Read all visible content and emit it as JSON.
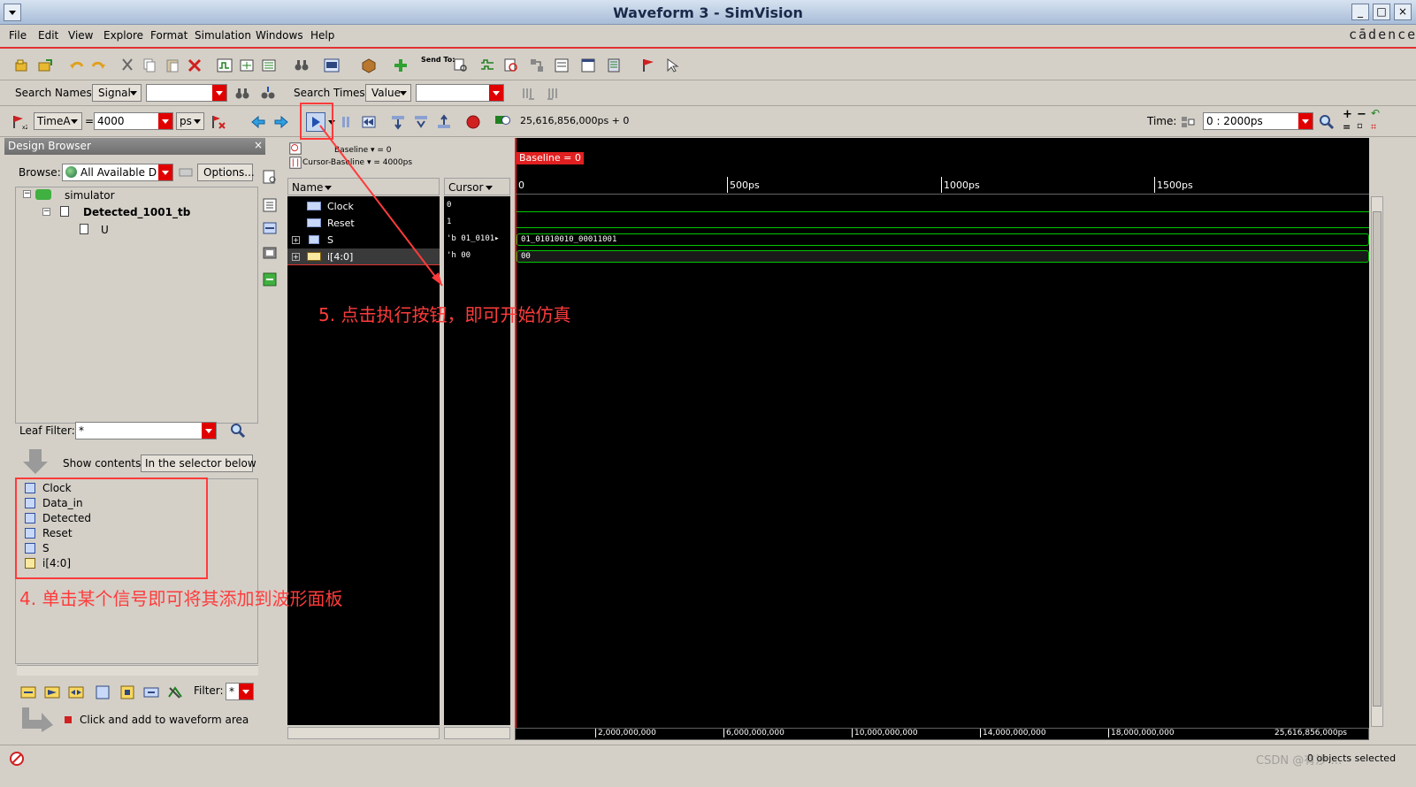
{
  "window": {
    "title": "Waveform 3 - SimVision",
    "brand": "cādence",
    "controls": [
      "_",
      "□",
      "×"
    ]
  },
  "menu": [
    "File",
    "Edit",
    "View",
    "Explore",
    "Format",
    "Simulation",
    "Windows",
    "Help"
  ],
  "toolbar": {
    "send_to_label": "Send To:"
  },
  "search": {
    "names_label": "Search Names:",
    "names_type": "Signal",
    "names_value": "",
    "times_label": "Search Times:",
    "times_type": "Value",
    "times_value": ""
  },
  "time_bar": {
    "time_marker": "TimeA",
    "equals": "=",
    "time_value": "4000",
    "time_unit": "ps",
    "sim_time": "25,616,856,000ps + 0",
    "time_label": "Time:",
    "time_range": "0 : 2000ps"
  },
  "design_browser": {
    "title": "Design Browser",
    "browse_label": "Browse:",
    "browse_value": "All Available D",
    "options_label": "Options...",
    "tree": [
      {
        "label": "simulator"
      },
      {
        "label": "Detected_1001_tb"
      },
      {
        "label": "U"
      }
    ],
    "leaf_filter_label": "Leaf Filter:",
    "leaf_filter_value": "*",
    "show_contents_label": "Show contents:",
    "show_contents_value": "In the selector below",
    "signals": [
      "Clock",
      "Data_in",
      "Detected",
      "Reset",
      "S",
      "i[4:0]"
    ],
    "filter_label": "Filter:",
    "filter_value": "*",
    "click_add_label": "Click and add to waveform area"
  },
  "waveform": {
    "baseline_text": "Baseline ▾ = 0",
    "cursor_baseline_text": "Cursor-Baseline ▾ = 4000ps",
    "name_header": "Name",
    "cursor_header": "Cursor",
    "baseline_marker": "Baseline = 0",
    "ruler_ticks": [
      "0",
      "500ps",
      "1000ps",
      "1500ps"
    ],
    "signals": [
      {
        "name": "Clock",
        "cursor": "0",
        "wave": ""
      },
      {
        "name": "Reset",
        "cursor": "1",
        "wave": ""
      },
      {
        "name": "S",
        "cursor": "'b 01_0101▸",
        "wave": "01_01010010_00011001"
      },
      {
        "name": "i[4:0]",
        "cursor": "'h 00",
        "wave": "00"
      }
    ],
    "bottom_ticks": [
      "2,000,000,000",
      "6,000,000,000",
      "10,000,000,000",
      "14,000,000,000",
      "18,000,000,000",
      "25,616,856,000ps"
    ]
  },
  "annotations": {
    "step5": "5. 点击执行按钮，即可开始仿真",
    "step4": "4. 单击某个信号即可将其添加到波形面板"
  },
  "status": {
    "right_text": "0 objects selected",
    "watermark": "CSDN @有沙 …"
  },
  "colors": {
    "accent_red": "#ff3b3b",
    "wave_green": "#00c800",
    "title_bar": "#b8cce4"
  }
}
